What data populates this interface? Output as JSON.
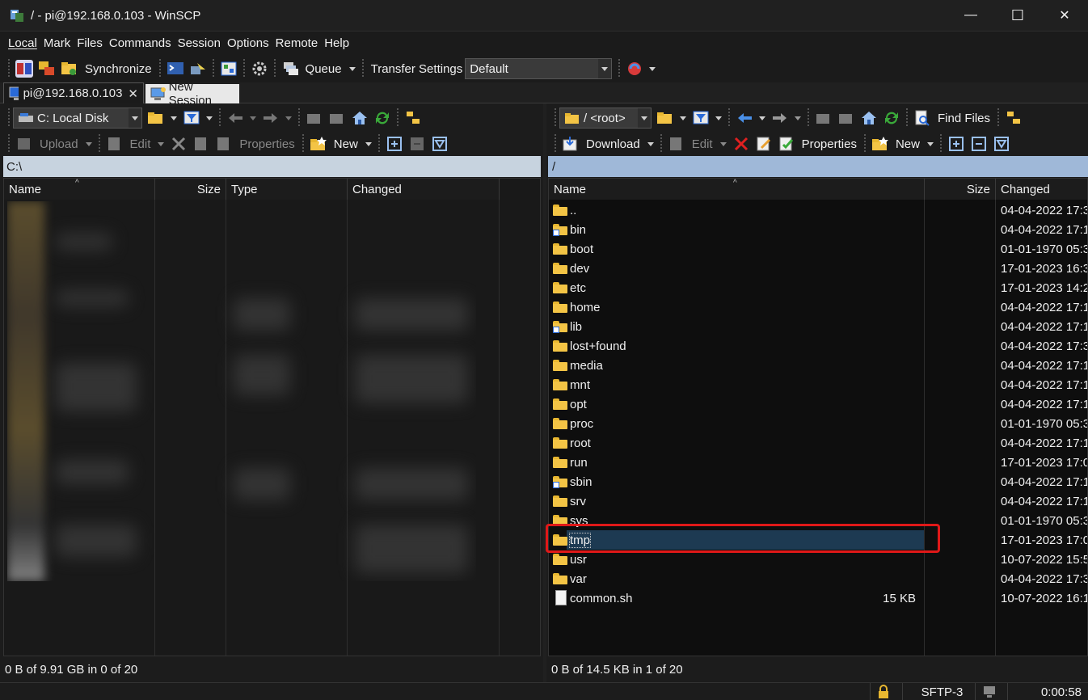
{
  "window": {
    "title": "/ - pi@192.168.0.103 - WinSCP",
    "minimize": "—",
    "maximize": "☐",
    "close": "✕"
  },
  "menu": [
    "Local",
    "Mark",
    "Files",
    "Commands",
    "Session",
    "Options",
    "Remote",
    "Help"
  ],
  "toolbar": {
    "synchronize": "Synchronize",
    "queue": "Queue",
    "transfer_settings": "Transfer Settings",
    "transfer_profile": "Default"
  },
  "tabs": {
    "active": "pi@192.168.0.103",
    "new_session": "New Session"
  },
  "left_panel": {
    "drive": "C: Local Disk",
    "upload": "Upload",
    "edit": "Edit",
    "properties": "Properties",
    "new": "New",
    "path": "C:\\",
    "columns": [
      "Name",
      "Size",
      "Type",
      "Changed"
    ],
    "status": "0 B of 9.91 GB in 0 of 20"
  },
  "right_panel": {
    "drive": "/ <root>",
    "find_files": "Find Files",
    "download": "Download",
    "edit": "Edit",
    "properties": "Properties",
    "new": "New",
    "path": "/",
    "columns": [
      "Name",
      "Size",
      "Changed"
    ],
    "files": [
      {
        "name": "..",
        "size": "",
        "changed": "04-04-2022 17:3",
        "kind": "parent"
      },
      {
        "name": "bin",
        "size": "",
        "changed": "04-04-2022 17:1",
        "kind": "link"
      },
      {
        "name": "boot",
        "size": "",
        "changed": "01-01-1970 05:3",
        "kind": "folder"
      },
      {
        "name": "dev",
        "size": "",
        "changed": "17-01-2023 16:3",
        "kind": "folder"
      },
      {
        "name": "etc",
        "size": "",
        "changed": "17-01-2023 14:2",
        "kind": "folder"
      },
      {
        "name": "home",
        "size": "",
        "changed": "04-04-2022 17:1",
        "kind": "folder"
      },
      {
        "name": "lib",
        "size": "",
        "changed": "04-04-2022 17:1",
        "kind": "link"
      },
      {
        "name": "lost+found",
        "size": "",
        "changed": "04-04-2022 17:3",
        "kind": "folder"
      },
      {
        "name": "media",
        "size": "",
        "changed": "04-04-2022 17:1",
        "kind": "folder"
      },
      {
        "name": "mnt",
        "size": "",
        "changed": "04-04-2022 17:1",
        "kind": "folder"
      },
      {
        "name": "opt",
        "size": "",
        "changed": "04-04-2022 17:1",
        "kind": "folder"
      },
      {
        "name": "proc",
        "size": "",
        "changed": "01-01-1970 05:3",
        "kind": "folder"
      },
      {
        "name": "root",
        "size": "",
        "changed": "04-04-2022 17:1",
        "kind": "folder"
      },
      {
        "name": "run",
        "size": "",
        "changed": "17-01-2023 17:0",
        "kind": "folder"
      },
      {
        "name": "sbin",
        "size": "",
        "changed": "04-04-2022 17:1",
        "kind": "link"
      },
      {
        "name": "srv",
        "size": "",
        "changed": "04-04-2022 17:1",
        "kind": "folder"
      },
      {
        "name": "sys",
        "size": "",
        "changed": "01-01-1970 05:3",
        "kind": "folder"
      },
      {
        "name": "tmp",
        "size": "",
        "changed": "17-01-2023 17:0",
        "kind": "folder",
        "selected": true
      },
      {
        "name": "usr",
        "size": "",
        "changed": "10-07-2022 15:5",
        "kind": "folder"
      },
      {
        "name": "var",
        "size": "",
        "changed": "04-04-2022 17:3",
        "kind": "folder"
      },
      {
        "name": "common.sh",
        "size": "15 KB",
        "changed": "10-07-2022 16:1",
        "kind": "file"
      }
    ],
    "status": "0 B of 14.5 KB in 1 of 20"
  },
  "statusbar": {
    "protocol": "SFTP-3",
    "elapsed": "0:00:58"
  },
  "colors": {
    "selection": "#1d3a52",
    "highlight_box": "#e01818",
    "folder": "#f3c445"
  }
}
